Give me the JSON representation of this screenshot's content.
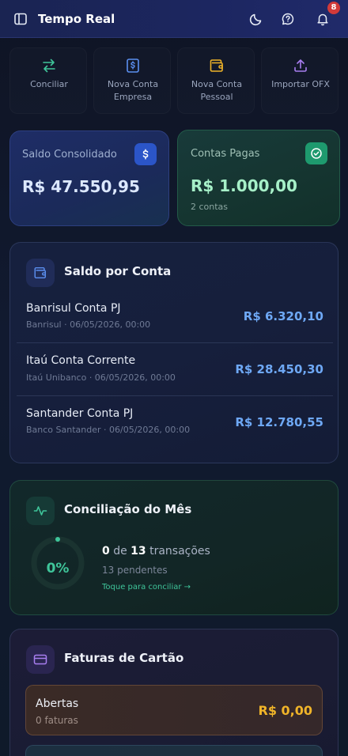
{
  "header": {
    "title": "Tempo Real",
    "notification_count": "8"
  },
  "quick_actions": [
    {
      "label_line1": "Conciliar",
      "label_line2": "",
      "icon": "arrows-exchange-icon",
      "color": "#3fc59a"
    },
    {
      "label_line1": "Nova Conta",
      "label_line2": "Empresa",
      "icon": "dollar-document-icon",
      "color": "#5b8ff0"
    },
    {
      "label_line1": "Nova Conta",
      "label_line2": "Pessoal",
      "icon": "wallet-icon",
      "color": "#f0b429"
    },
    {
      "label_line1": "Importar OFX",
      "label_line2": "",
      "icon": "upload-icon",
      "color": "#a87ef0"
    }
  ],
  "summary": {
    "saldo_label": "Saldo Consolidado",
    "saldo_value": "R$ 47.550,95",
    "pagas_label": "Contas Pagas",
    "pagas_value": "R$ 1.000,00",
    "pagas_count": "2 contas"
  },
  "accounts_panel": {
    "title": "Saldo por Conta",
    "accounts": [
      {
        "name": "Banrisul Conta PJ",
        "meta": "Banrisul · 06/05/2026, 00:00",
        "value": "R$ 6.320,10"
      },
      {
        "name": "Itaú Conta Corrente",
        "meta": "Itaú Unibanco · 06/05/2026, 00:00",
        "value": "R$ 28.450,30"
      },
      {
        "name": "Santander Conta PJ",
        "meta": "Banco Santander · 06/05/2026, 00:00",
        "value": "R$ 12.780,55"
      }
    ]
  },
  "concil_panel": {
    "title": "Conciliação do Mês",
    "percent": "0%",
    "done": "0",
    "of_word": "de",
    "total": "13",
    "tx_word": "transações",
    "pending": "13 pendentes",
    "cta": "Toque para conciliar →"
  },
  "faturas_panel": {
    "title": "Faturas de Cartão",
    "open_label": "Abertas",
    "open_count": "0 faturas",
    "open_value": "R$ 0,00"
  },
  "colors": {
    "accent_blue": "#6ea8f5",
    "accent_green": "#3fc59a",
    "accent_yellow": "#f0b429",
    "badge_red": "#d23a3a"
  }
}
